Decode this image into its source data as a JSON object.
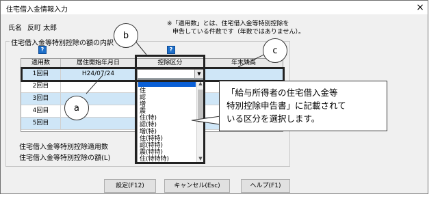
{
  "dialog": {
    "title": "住宅借入金情報入力",
    "close": "×"
  },
  "name_row": {
    "label": "氏名",
    "value": "反町 太郎"
  },
  "note": {
    "line1": "※「適用数」とは、住宅借入金等特別控除を",
    "line2": "申告している件数です（年数ではありません）。"
  },
  "group": {
    "title": "住宅借入金等特別控除の額の内訳",
    "help": "?"
  },
  "table": {
    "headers": [
      "適用数",
      "居住開始年月日",
      "控除区分",
      "年末残高"
    ],
    "rows": [
      {
        "no": "1回目",
        "date": "H24/07/24",
        "kubun": "",
        "zandaka": ""
      },
      {
        "no": "2回目",
        "date": "",
        "kubun": "",
        "zandaka": ""
      },
      {
        "no": "3回目",
        "date": "",
        "kubun": "",
        "zandaka": ""
      },
      {
        "no": "4回目",
        "date": "",
        "kubun": "",
        "zandaka": ""
      },
      {
        "no": "5回目",
        "date": "",
        "kubun": "",
        "zandaka": ""
      }
    ]
  },
  "dropdown": {
    "options": [
      "住",
      "認",
      "増",
      "震",
      "住(特)",
      "認(特)",
      "増(特)",
      "住(特特)",
      "認(特特)",
      "震(特特)",
      "住(特特特)"
    ],
    "selected_index": 0
  },
  "labels": {
    "applied_count": "住宅借入金等特別控除適用数",
    "deduction_amount": "住宅借入金等特別控除の額(L)"
  },
  "buttons": {
    "ok": "設定(F12)",
    "cancel": "キャンセル(Esc)",
    "help": "ヘルプ(F1)"
  },
  "callouts": {
    "a": "a",
    "b": "b",
    "c": "c",
    "tip_line1": "「給与所得者の住宅借入金等",
    "tip_line2": "特別控除申告書」に記載されて",
    "tip_line3": "いる区分を選択します。"
  }
}
